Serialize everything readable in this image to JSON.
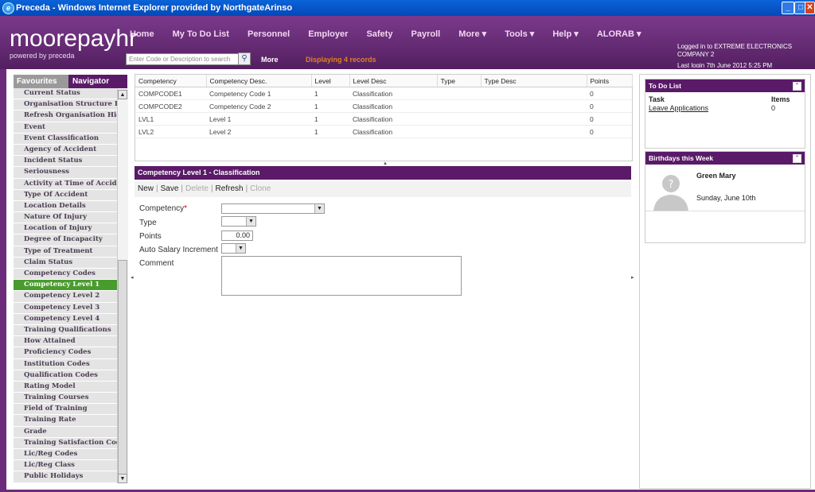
{
  "window": {
    "title": "Preceda - Windows Internet Explorer provided by NorthgateArinso"
  },
  "brand": {
    "logo": "moorepayhr",
    "tagline": "powered by preceda"
  },
  "nav": {
    "items": [
      "Home",
      "My To Do List",
      "Personnel",
      "Employer",
      "Safety",
      "Payroll",
      "More ▾",
      "Tools ▾",
      "Help ▾",
      "ALORAB ▾"
    ]
  },
  "search": {
    "placeholder": "Enter Code or Description to search",
    "more": "More",
    "status": "Displaying 4 records"
  },
  "session": {
    "logged_in": "Logged in to EXTREME ELECTRONICS COMPANY 2",
    "last_login": "Last login 7th June 2012 5:25 PM"
  },
  "sidebar": {
    "tabs": [
      "Favourites",
      "Navigator"
    ],
    "items": [
      "Current Status",
      "Organisation Structure Re...",
      "Refresh Organisation Hiera...",
      "Event",
      "Event Classification",
      "Agency of Accident",
      "Incident Status",
      "Seriousness",
      "Activity at Time of Accident",
      "Type Of Accident",
      "Location Details",
      "Nature Of Injury",
      "Location of Injury",
      "Degree of Incapacity",
      "Type of Treatment",
      "Claim Status",
      "Competency Codes",
      "Competency Level 1",
      "Competency Level 2",
      "Competency Level 3",
      "Competency Level 4",
      "Training Qualifications",
      "How Attained",
      "Proficiency Codes",
      "Institution Codes",
      "Qualification Codes",
      "Rating Model",
      "Training Courses",
      "Field of Training",
      "Training Rate",
      "Grade",
      "Training Satisfaction Codes",
      "Lic/Reg Codes",
      "Lic/Reg Class",
      "Public Holidays"
    ],
    "active_index": 17
  },
  "grid": {
    "columns": [
      "Competency",
      "Competency Desc.",
      "Level",
      "Level Desc",
      "Type",
      "Type Desc",
      "Points"
    ],
    "rows": [
      [
        "COMPCODE1",
        "Competency Code 1",
        "1",
        "Classification",
        "",
        "",
        "0"
      ],
      [
        "COMPCODE2",
        "Competency Code 2",
        "1",
        "Classification",
        "",
        "",
        "0"
      ],
      [
        "LVL1",
        "Level 1",
        "1",
        "Classification",
        "",
        "",
        "0"
      ],
      [
        "LVL2",
        "Level 2",
        "1",
        "Classification",
        "",
        "",
        "0"
      ]
    ]
  },
  "form": {
    "title": "Competency Level 1 - Classification",
    "toolbar": {
      "new": "New",
      "save": "Save",
      "delete": "Delete",
      "refresh": "Refresh",
      "clone": "Clone"
    },
    "labels": {
      "competency": "Competency",
      "type": "Type",
      "points": "Points",
      "auto_salary": "Auto Salary Increment",
      "comment": "Comment"
    },
    "required_mark": "*",
    "points_value": "0.00"
  },
  "todo": {
    "title": "To Do List",
    "task_header": "Task",
    "items_header": "Items",
    "task": "Leave Applications",
    "count": "0"
  },
  "birthdays": {
    "title": "Birthdays this Week",
    "name": "Green Mary",
    "date": "Sunday, June 10th"
  },
  "colors": {
    "primary": "#5a1a68",
    "active": "#4a9b2e",
    "nav_text": "#f4d6f2",
    "status": "#e08020"
  }
}
